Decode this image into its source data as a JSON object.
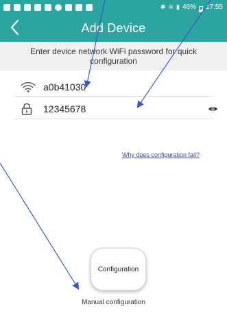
{
  "status_bar": {
    "battery_text": "46%",
    "time_text": "17:55",
    "notification_icons": [
      "notification-icon",
      "notification-icon",
      "notification-icon",
      "notification-icon",
      "notification-icon",
      "notification-icon",
      "notification-icon",
      "notification-icon",
      "notification-icon"
    ]
  },
  "header": {
    "title": "Add Device",
    "back_icon": "chevron-left-icon",
    "background_color": "#2ca5a0"
  },
  "instruction": {
    "text": "Enter device network WiFi password for quick configuration"
  },
  "wifi": {
    "ssid": "a0b41030",
    "ssid_icon": "wifi-icon",
    "password": "12345678",
    "password_icon": "lock-icon",
    "visibility_icon": "eye-icon"
  },
  "help": {
    "link_text": "Why does configuration fail?"
  },
  "actions": {
    "configuration_label": "Configuration",
    "manual_label": "Manual configuration"
  }
}
